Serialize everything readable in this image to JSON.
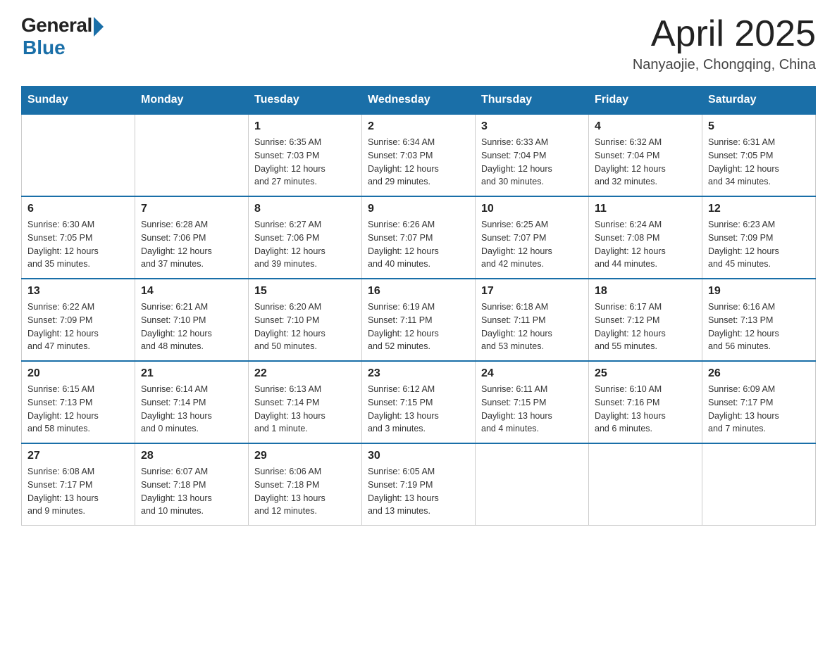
{
  "header": {
    "logo_general": "General",
    "logo_blue": "Blue",
    "title": "April 2025",
    "location": "Nanyaojie, Chongqing, China"
  },
  "days_of_week": [
    "Sunday",
    "Monday",
    "Tuesday",
    "Wednesday",
    "Thursday",
    "Friday",
    "Saturday"
  ],
  "weeks": [
    [
      {
        "day": "",
        "info": ""
      },
      {
        "day": "",
        "info": ""
      },
      {
        "day": "1",
        "info": "Sunrise: 6:35 AM\nSunset: 7:03 PM\nDaylight: 12 hours\nand 27 minutes."
      },
      {
        "day": "2",
        "info": "Sunrise: 6:34 AM\nSunset: 7:03 PM\nDaylight: 12 hours\nand 29 minutes."
      },
      {
        "day": "3",
        "info": "Sunrise: 6:33 AM\nSunset: 7:04 PM\nDaylight: 12 hours\nand 30 minutes."
      },
      {
        "day": "4",
        "info": "Sunrise: 6:32 AM\nSunset: 7:04 PM\nDaylight: 12 hours\nand 32 minutes."
      },
      {
        "day": "5",
        "info": "Sunrise: 6:31 AM\nSunset: 7:05 PM\nDaylight: 12 hours\nand 34 minutes."
      }
    ],
    [
      {
        "day": "6",
        "info": "Sunrise: 6:30 AM\nSunset: 7:05 PM\nDaylight: 12 hours\nand 35 minutes."
      },
      {
        "day": "7",
        "info": "Sunrise: 6:28 AM\nSunset: 7:06 PM\nDaylight: 12 hours\nand 37 minutes."
      },
      {
        "day": "8",
        "info": "Sunrise: 6:27 AM\nSunset: 7:06 PM\nDaylight: 12 hours\nand 39 minutes."
      },
      {
        "day": "9",
        "info": "Sunrise: 6:26 AM\nSunset: 7:07 PM\nDaylight: 12 hours\nand 40 minutes."
      },
      {
        "day": "10",
        "info": "Sunrise: 6:25 AM\nSunset: 7:07 PM\nDaylight: 12 hours\nand 42 minutes."
      },
      {
        "day": "11",
        "info": "Sunrise: 6:24 AM\nSunset: 7:08 PM\nDaylight: 12 hours\nand 44 minutes."
      },
      {
        "day": "12",
        "info": "Sunrise: 6:23 AM\nSunset: 7:09 PM\nDaylight: 12 hours\nand 45 minutes."
      }
    ],
    [
      {
        "day": "13",
        "info": "Sunrise: 6:22 AM\nSunset: 7:09 PM\nDaylight: 12 hours\nand 47 minutes."
      },
      {
        "day": "14",
        "info": "Sunrise: 6:21 AM\nSunset: 7:10 PM\nDaylight: 12 hours\nand 48 minutes."
      },
      {
        "day": "15",
        "info": "Sunrise: 6:20 AM\nSunset: 7:10 PM\nDaylight: 12 hours\nand 50 minutes."
      },
      {
        "day": "16",
        "info": "Sunrise: 6:19 AM\nSunset: 7:11 PM\nDaylight: 12 hours\nand 52 minutes."
      },
      {
        "day": "17",
        "info": "Sunrise: 6:18 AM\nSunset: 7:11 PM\nDaylight: 12 hours\nand 53 minutes."
      },
      {
        "day": "18",
        "info": "Sunrise: 6:17 AM\nSunset: 7:12 PM\nDaylight: 12 hours\nand 55 minutes."
      },
      {
        "day": "19",
        "info": "Sunrise: 6:16 AM\nSunset: 7:13 PM\nDaylight: 12 hours\nand 56 minutes."
      }
    ],
    [
      {
        "day": "20",
        "info": "Sunrise: 6:15 AM\nSunset: 7:13 PM\nDaylight: 12 hours\nand 58 minutes."
      },
      {
        "day": "21",
        "info": "Sunrise: 6:14 AM\nSunset: 7:14 PM\nDaylight: 13 hours\nand 0 minutes."
      },
      {
        "day": "22",
        "info": "Sunrise: 6:13 AM\nSunset: 7:14 PM\nDaylight: 13 hours\nand 1 minute."
      },
      {
        "day": "23",
        "info": "Sunrise: 6:12 AM\nSunset: 7:15 PM\nDaylight: 13 hours\nand 3 minutes."
      },
      {
        "day": "24",
        "info": "Sunrise: 6:11 AM\nSunset: 7:15 PM\nDaylight: 13 hours\nand 4 minutes."
      },
      {
        "day": "25",
        "info": "Sunrise: 6:10 AM\nSunset: 7:16 PM\nDaylight: 13 hours\nand 6 minutes."
      },
      {
        "day": "26",
        "info": "Sunrise: 6:09 AM\nSunset: 7:17 PM\nDaylight: 13 hours\nand 7 minutes."
      }
    ],
    [
      {
        "day": "27",
        "info": "Sunrise: 6:08 AM\nSunset: 7:17 PM\nDaylight: 13 hours\nand 9 minutes."
      },
      {
        "day": "28",
        "info": "Sunrise: 6:07 AM\nSunset: 7:18 PM\nDaylight: 13 hours\nand 10 minutes."
      },
      {
        "day": "29",
        "info": "Sunrise: 6:06 AM\nSunset: 7:18 PM\nDaylight: 13 hours\nand 12 minutes."
      },
      {
        "day": "30",
        "info": "Sunrise: 6:05 AM\nSunset: 7:19 PM\nDaylight: 13 hours\nand 13 minutes."
      },
      {
        "day": "",
        "info": ""
      },
      {
        "day": "",
        "info": ""
      },
      {
        "day": "",
        "info": ""
      }
    ]
  ]
}
